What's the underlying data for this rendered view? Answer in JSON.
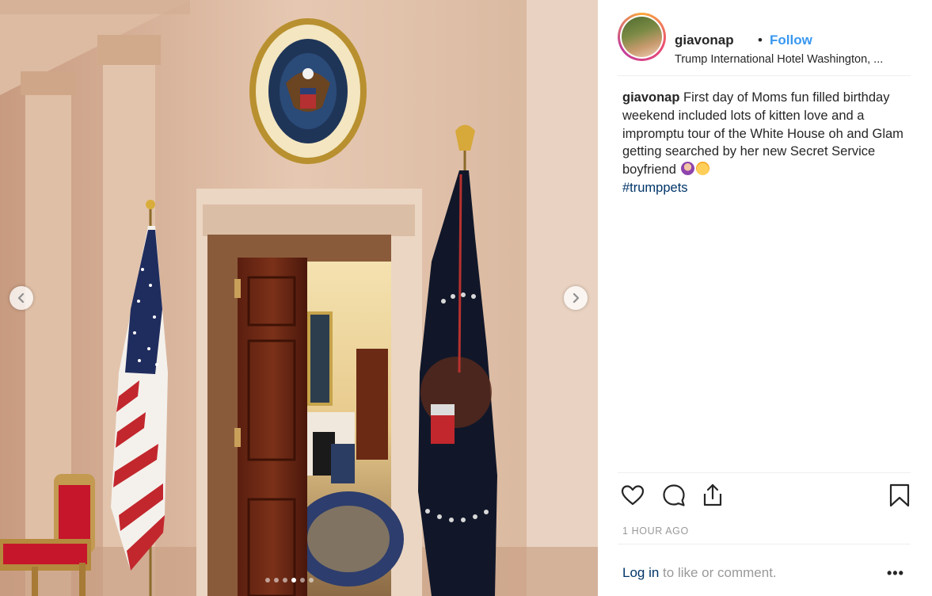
{
  "post": {
    "username": "giavonap",
    "separator": "•",
    "follow_label": "Follow",
    "location": "Trump International Hotel Washington, ...",
    "caption_user": "giavonap",
    "caption_text": "First day of Moms fun filled birthday weekend included lots of kitten love and a impromptu tour of the White House oh and Glam getting searched by her new Secret Service boyfriend",
    "hashtag": "#trumppets",
    "timestamp": "1 HOUR AGO"
  },
  "footer": {
    "login_link": "Log in",
    "login_rest": " to like or comment.",
    "more": "•••"
  },
  "carousel": {
    "total_slides": 6,
    "active_index": 3
  },
  "seal_text": "SEAL OF THE PRESIDENT OF THE UNITED STATES",
  "icons": {
    "prev": "chevron-left-icon",
    "next": "chevron-right-icon",
    "like": "heart-icon",
    "comment": "comment-bubble-icon",
    "share": "share-icon",
    "save": "bookmark-icon"
  }
}
